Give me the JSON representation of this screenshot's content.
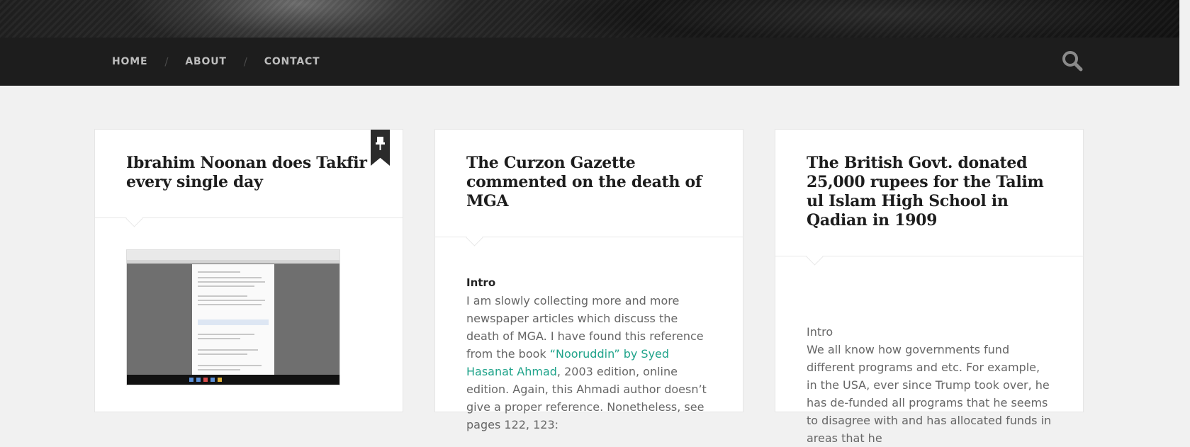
{
  "nav": {
    "items": [
      {
        "label": "Home"
      },
      {
        "label": "About"
      },
      {
        "label": "Contact"
      }
    ],
    "separator": "/",
    "search_icon": "search-icon"
  },
  "posts": [
    {
      "title": "Ibrahim Noonan does Takfir every single day",
      "sticky": true,
      "sticky_icon": "pin-icon",
      "featured_image": "screenshot of a twitter thread in a browser window"
    },
    {
      "title": "The Curzon Gazette commented on the death of MGA",
      "intro_label": "Intro",
      "excerpt_before": "I am slowly collecting more and more newspaper articles which discuss the death of MGA.  I have found this reference from the book ",
      "excerpt_link": "“Nooruddin” by Syed Hasanat Ahmad",
      "excerpt_after": ", 2003 edition, online edition.  Again, this Ahmadi author doesn’t give a proper reference.  Nonetheless, see pages 122, 123:"
    },
    {
      "title": "The British Govt. donated 25,000 rupees for the Talim ul Islam High School in Qadian in 1909",
      "intro_label": "Intro",
      "excerpt": "We all know how governments fund different programs and etc.  For example, in the USA, ever since Trump took over, he has de-funded all programs that he seems to disagree with and has allocated funds in areas that he"
    }
  ],
  "colors": {
    "navbar": "#1d1d1d",
    "link": "#1fa38a",
    "page_bg": "#f1f1f1"
  }
}
